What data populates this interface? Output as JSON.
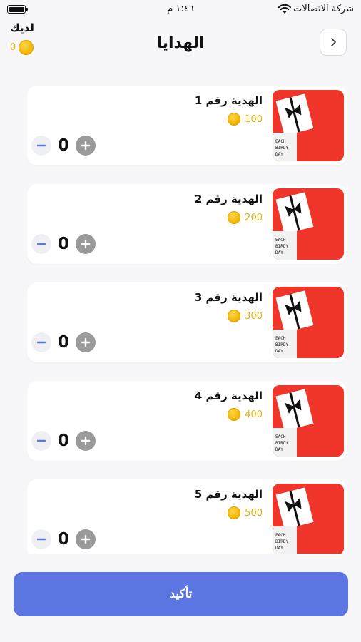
{
  "status_bar": {
    "carrier": "شركة الاتصالات",
    "time": "١:٤٦ م"
  },
  "header": {
    "title": "الهدايا",
    "balance_label": "لديك",
    "balance_value": "0"
  },
  "items": [
    {
      "name": "الهدية رقم 1",
      "price": "100",
      "quantity": "0"
    },
    {
      "name": "الهدية رقم 2",
      "price": "200",
      "quantity": "0"
    },
    {
      "name": "الهدية رقم 3",
      "price": "300",
      "quantity": "0"
    },
    {
      "name": "الهدية رقم 4",
      "price": "400",
      "quantity": "0"
    },
    {
      "name": "الهدية رقم 5",
      "price": "500",
      "quantity": "0"
    }
  ],
  "confirm_label": "تأكيد",
  "colors": {
    "accent": "#5b75e1",
    "coin": "#f2b705",
    "price_text": "#e3b40f",
    "thumb_bg": "#f0362a"
  },
  "icons": {
    "back": "chevron-right-icon",
    "coin": "coin-icon",
    "plus": "plus-circle-icon",
    "minus": "minus-icon",
    "wifi": "wifi-icon",
    "battery": "battery-icon"
  }
}
